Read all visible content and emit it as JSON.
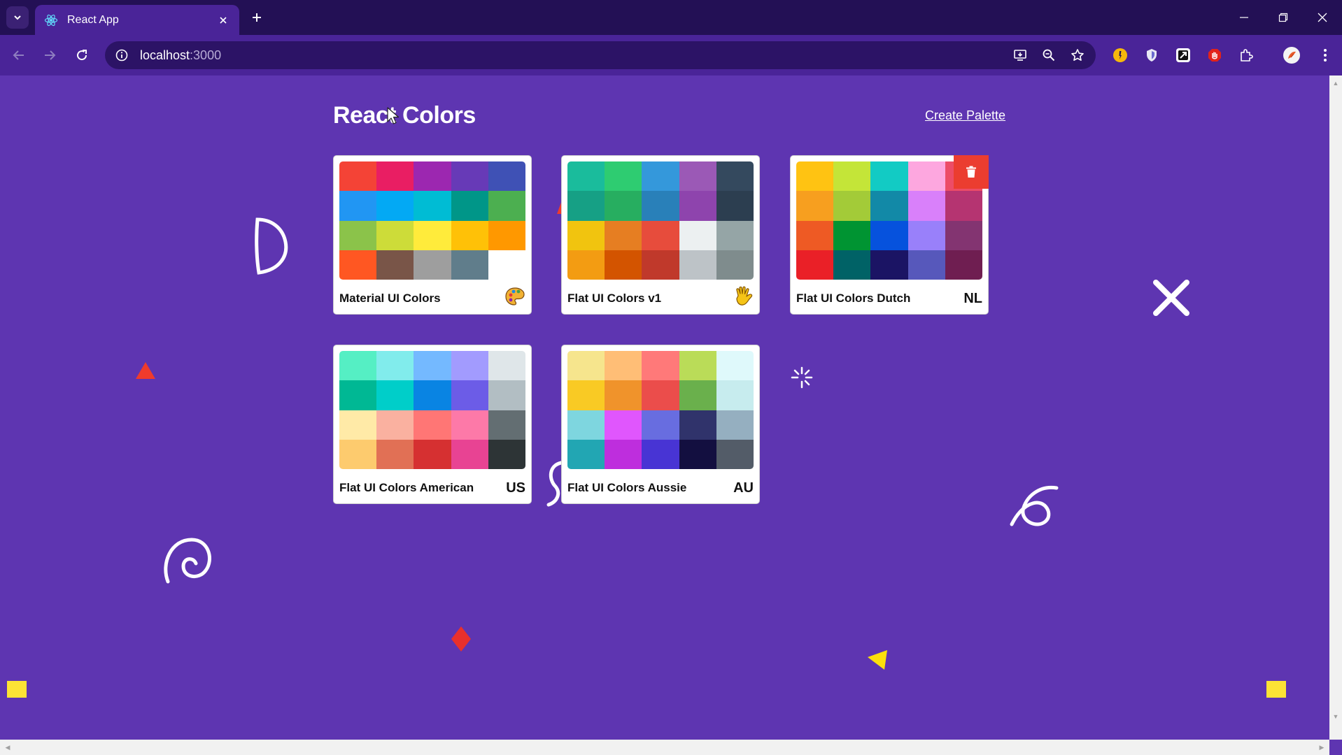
{
  "browser": {
    "tab_title": "React App",
    "url_host": "localhost",
    "url_port": ":3000"
  },
  "page": {
    "brand": "React Colors",
    "create_link": "Create Palette"
  },
  "palettes": [
    {
      "name": "Material UI Colors",
      "emoji_icon": "palette-emoji",
      "colors": [
        "#f44336",
        "#e91e63",
        "#9c27b0",
        "#673ab7",
        "#3f51b5",
        "#2196f3",
        "#03a9f4",
        "#00bcd4",
        "#009688",
        "#4caf50",
        "#8bc34a",
        "#cddc39",
        "#ffeb3b",
        "#ffc107",
        "#ff9800",
        "#ff5722",
        "#795548",
        "#9e9e9e",
        "#607d8b",
        "#ffffff"
      ]
    },
    {
      "name": "Flat UI Colors v1",
      "emoji_icon": "hand-emoji",
      "colors": [
        "#1abc9c",
        "#2ecc71",
        "#3498db",
        "#9b59b6",
        "#34495e",
        "#16a085",
        "#27ae60",
        "#2980b9",
        "#8e44ad",
        "#2c3e50",
        "#f1c40f",
        "#e67e22",
        "#e74c3c",
        "#ecf0f1",
        "#95a5a6",
        "#f39c12",
        "#d35400",
        "#c0392b",
        "#bdc3c7",
        "#7f8c8d"
      ]
    },
    {
      "name": "Flat UI Colors Dutch",
      "emoji": "NL",
      "colors": [
        "#ffc312",
        "#c4e538",
        "#12cbc4",
        "#fda7df",
        "#ed4c67",
        "#f79f1f",
        "#a3cb38",
        "#1289a7",
        "#d980fa",
        "#b53471",
        "#ee5a24",
        "#009432",
        "#0652dd",
        "#9980fa",
        "#833471",
        "#ea2027",
        "#006266",
        "#1b1464",
        "#5758bb",
        "#6f1e51"
      ]
    },
    {
      "name": "Flat UI Colors American",
      "emoji": "US",
      "colors": [
        "#55efc4",
        "#81ecec",
        "#74b9ff",
        "#a29bfe",
        "#dfe6e9",
        "#00b894",
        "#00cec9",
        "#0984e3",
        "#6c5ce7",
        "#b2bec3",
        "#ffeaa7",
        "#fab1a0",
        "#ff7675",
        "#fd79a8",
        "#636e72",
        "#fdcb6e",
        "#e17055",
        "#d63031",
        "#e84393",
        "#2d3436"
      ]
    },
    {
      "name": "Flat UI Colors Aussie",
      "emoji": "AU",
      "colors": [
        "#f6e58d",
        "#ffbe76",
        "#ff7979",
        "#badc58",
        "#dff9fb",
        "#f9ca24",
        "#f0932b",
        "#eb4d4b",
        "#6ab04c",
        "#c7ecee",
        "#7ed6df",
        "#e056fd",
        "#686de0",
        "#30336b",
        "#95afc0",
        "#22a6b3",
        "#be2edd",
        "#4834d4",
        "#130f40",
        "#535c68"
      ]
    }
  ]
}
